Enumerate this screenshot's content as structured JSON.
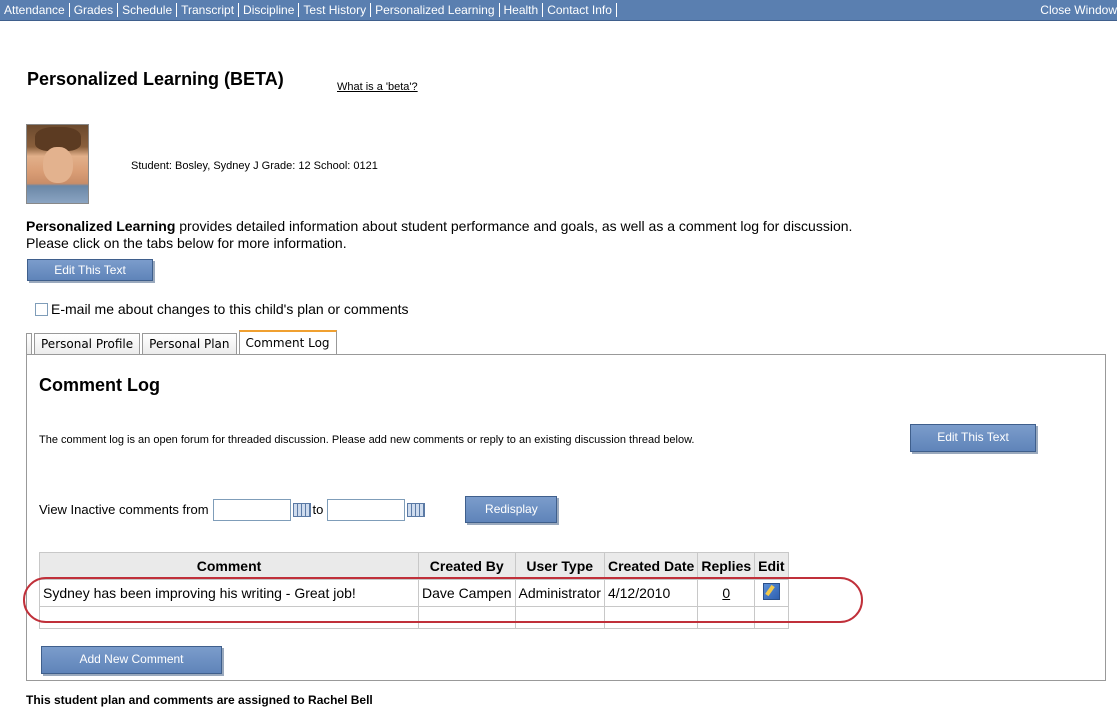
{
  "nav": {
    "items": [
      "Attendance",
      "Grades",
      "Schedule",
      "Transcript",
      "Discipline",
      "Test History",
      "Personalized Learning",
      "Health",
      "Contact Info"
    ],
    "close_label": "Close Window"
  },
  "page": {
    "title": "Personalized Learning (BETA)",
    "beta_link": "What is a 'beta'?"
  },
  "student": {
    "info": "Student: Bosley, Sydney J Grade: 12 School: 0121"
  },
  "description": {
    "bold": "Personalized Learning",
    "line1_rest": " provides detailed information about student performance and goals, as well as a comment log for discussion.",
    "line2": "Please click on the tabs below for more information.",
    "edit_button": "Edit This Text"
  },
  "email_option": {
    "label": "E-mail me about changes to this child's plan or comments",
    "checked": false
  },
  "tabs": [
    "Personal Profile",
    "Personal Plan",
    "Comment Log"
  ],
  "active_tab": "Comment Log",
  "comment_log": {
    "title": "Comment Log",
    "description": "The comment log is an open forum for threaded discussion. Please add new comments or reply to an existing discussion thread below.",
    "edit_button": "Edit This Text",
    "inactive_label": "View Inactive comments from",
    "to_label": "to",
    "from_value": "",
    "to_value": "",
    "redisplay_button": "Redisplay",
    "columns": [
      "Comment",
      "Created By",
      "User Type",
      "Created Date",
      "Replies",
      "Edit"
    ],
    "rows": [
      {
        "comment": "Sydney has been improving his writing - Great job!",
        "created_by": "Dave Campen",
        "user_type": "Administrator",
        "created_date": "4/12/2010",
        "replies": "0"
      }
    ],
    "add_button": "Add New Comment"
  },
  "footer": {
    "assigned": "This student plan and comments are assigned to Rachel Bell"
  },
  "colors": {
    "nav_bg": "#5a7fb0",
    "button_bg": "#6a8ec3",
    "active_tab_accent": "#f0a030",
    "highlight": "#c0303a"
  },
  "icons": {
    "calendar": "calendar-icon",
    "edit": "edit-icon"
  }
}
